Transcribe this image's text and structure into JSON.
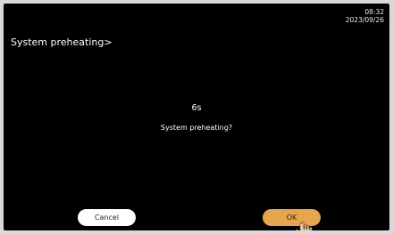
{
  "clock": {
    "time": "08:32",
    "date": "2023/09/26"
  },
  "header": {
    "title": "System preheating>"
  },
  "dialog": {
    "countdown": "6s",
    "message": "System preheating?",
    "cancel_label": "Cancel",
    "ok_label": "OK"
  },
  "colors": {
    "background": "#000000",
    "ok_button": "#e6a54f",
    "cancel_button": "#ffffff"
  },
  "icons": {
    "pointer": "hand-pointer-icon"
  }
}
